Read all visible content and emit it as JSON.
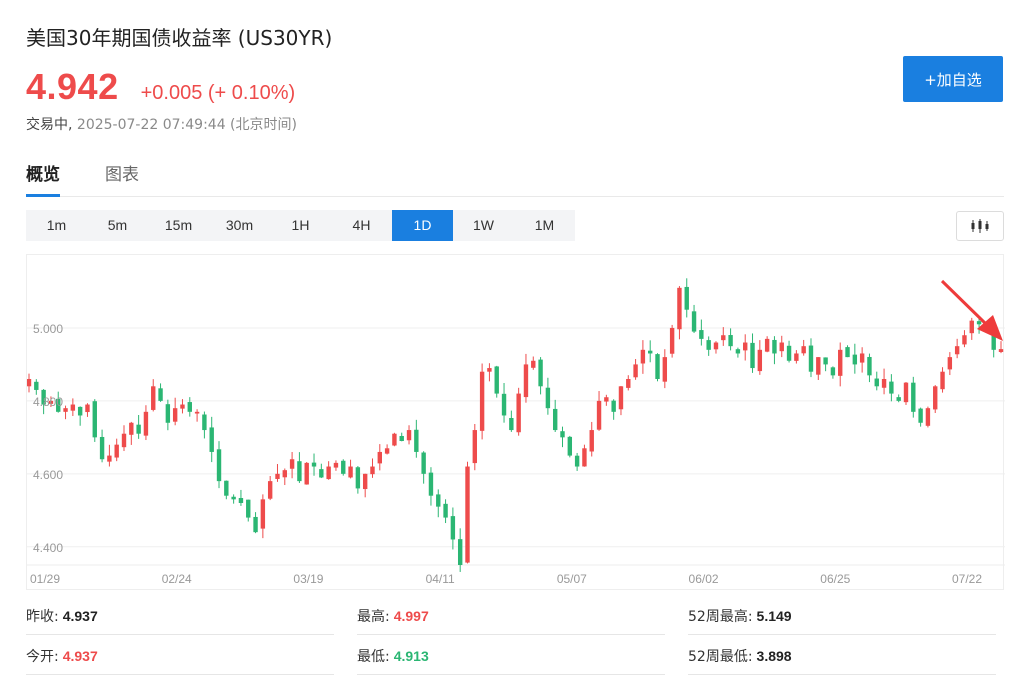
{
  "header": {
    "title": "美国30年期国债收益率 (US30YR)",
    "price": "4.942",
    "change": "+0.005 (+ 0.10%)",
    "status_label": "交易中,",
    "timestamp": "2025-07-22 07:49:44 (北京时间)",
    "add_watchlist": "+加自选"
  },
  "tabs": [
    {
      "label": "概览",
      "active": true
    },
    {
      "label": "图表",
      "active": false
    }
  ],
  "periods": [
    "1m",
    "5m",
    "15m",
    "30m",
    "1H",
    "4H",
    "1D",
    "1W",
    "1M"
  ],
  "active_period": "1D",
  "toggle_icon": "candlestick-chart-icon",
  "colors": {
    "up": "#ee4b4b",
    "down": "#2bb673",
    "accent": "#1a7fe0"
  },
  "chart_data": {
    "type": "candlestick",
    "y_ticks": [
      "4.400",
      "4.600",
      "4.800",
      "5.000"
    ],
    "y_range": [
      4.35,
      5.2
    ],
    "x_labels": [
      "01/29",
      "02/24",
      "03/19",
      "04/11",
      "05/07",
      "06/02",
      "06/25",
      "07/22"
    ],
    "grid": true,
    "closes": [
      4.86,
      4.83,
      4.79,
      4.8,
      4.77,
      4.78,
      4.79,
      4.76,
      4.79,
      4.7,
      4.64,
      4.65,
      4.68,
      4.71,
      4.74,
      4.71,
      4.77,
      4.84,
      4.8,
      4.74,
      4.78,
      4.79,
      4.77,
      4.77,
      4.72,
      4.66,
      4.58,
      4.54,
      4.53,
      4.52,
      4.48,
      4.44,
      4.53,
      4.58,
      4.6,
      4.61,
      4.64,
      4.58,
      4.63,
      4.62,
      4.59,
      4.62,
      4.63,
      4.6,
      4.62,
      4.56,
      4.6,
      4.62,
      4.66,
      4.67,
      4.71,
      4.69,
      4.72,
      4.66,
      4.6,
      4.54,
      4.51,
      4.48,
      4.42,
      4.35,
      4.62,
      4.72,
      4.88,
      4.89,
      4.82,
      4.76,
      4.72,
      4.82,
      4.9,
      4.91,
      4.84,
      4.78,
      4.72,
      4.7,
      4.65,
      4.62,
      4.67,
      4.72,
      4.8,
      4.81,
      4.77,
      4.84,
      4.86,
      4.9,
      4.94,
      4.93,
      4.86,
      4.92,
      5.0,
      5.11,
      5.05,
      4.99,
      4.97,
      4.94,
      4.96,
      4.98,
      4.95,
      4.93,
      4.96,
      4.89,
      4.94,
      4.97,
      4.93,
      4.96,
      4.91,
      4.93,
      4.95,
      4.88,
      4.92,
      4.9,
      4.87,
      4.94,
      4.92,
      4.9,
      4.93,
      4.87,
      4.84,
      4.86,
      4.82,
      4.8,
      4.85,
      4.77,
      4.74,
      4.78,
      4.84,
      4.88,
      4.92,
      4.95,
      4.98,
      5.02,
      5.01,
      5.0,
      4.94,
      4.942
    ],
    "day_start": "2025-01-27",
    "day_end": "2025-07-22"
  },
  "stats": [
    {
      "label": "昨收:",
      "value": "4.937",
      "tone": "dark"
    },
    {
      "label": "最高:",
      "value": "4.997",
      "tone": "red"
    },
    {
      "label": "52周最高:",
      "value": "5.149",
      "tone": "dark"
    },
    {
      "label": "今开:",
      "value": "4.937",
      "tone": "red"
    },
    {
      "label": "最低:",
      "value": "4.913",
      "tone": "green"
    },
    {
      "label": "52周最低:",
      "value": "3.898",
      "tone": "dark"
    }
  ]
}
